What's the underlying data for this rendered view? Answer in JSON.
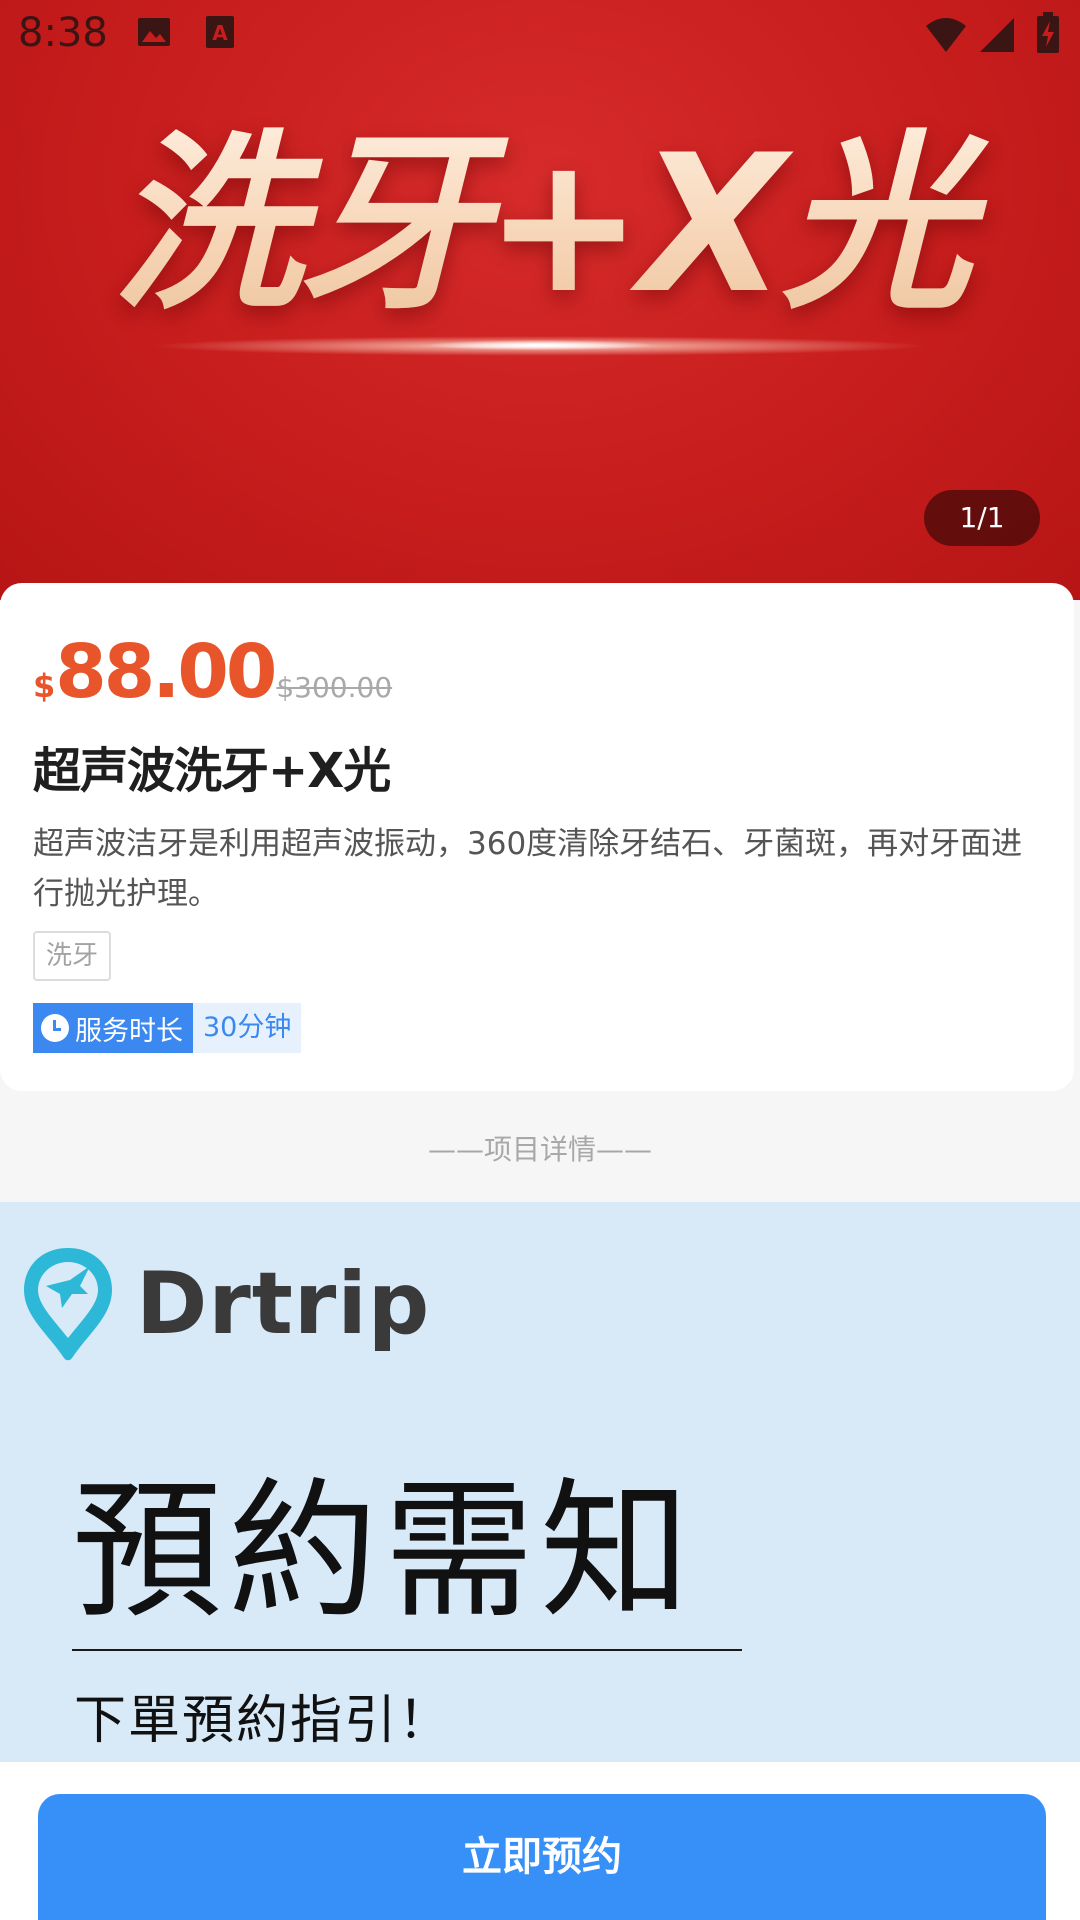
{
  "status_bar": {
    "time": "8:38",
    "icons": [
      "image-icon",
      "font-a-icon",
      "wifi-icon",
      "signal-icon",
      "battery-charging-icon"
    ]
  },
  "hero": {
    "title": "洗牙+X光",
    "pager": "1/1",
    "colors": {
      "background": "#c71d1d",
      "title": "#f7d6b8"
    }
  },
  "product": {
    "currency": "$",
    "price": "88.00",
    "original_price": "$300.00",
    "name": "超声波洗牙+X光",
    "description": "超声波洁牙是利用超声波振动，360度清除牙结石、牙菌斑，再对牙面进行抛光护理。",
    "tag": "洗牙",
    "duration_label": "服务时长",
    "duration_value": "30分钟",
    "colors": {
      "price": "#e8552a",
      "accent": "#3b89f0"
    }
  },
  "section": {
    "title": "——项目详情——"
  },
  "details_image": {
    "brand": "Drtrip",
    "title": "預約需知",
    "subtitle": "下單預約指引！",
    "background": "#d8e9f8",
    "logo_color": "#2cb8d6"
  },
  "bottom": {
    "book_label": "立即预约",
    "button_color": "#3790f7"
  }
}
